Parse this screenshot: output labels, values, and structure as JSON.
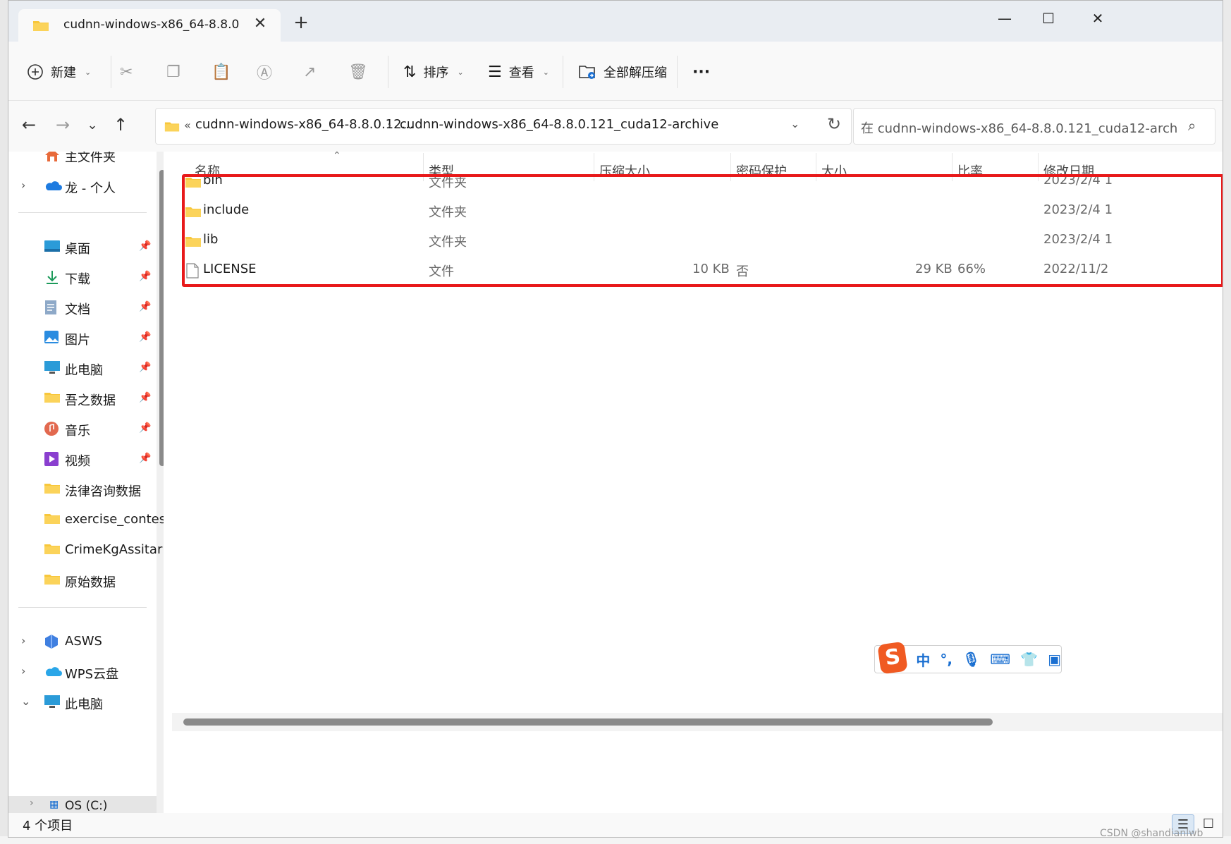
{
  "window": {
    "tab_title": "cudnn-windows-x86_64-8.8.0",
    "tab_close": "✕",
    "new_tab": "+",
    "minimize": "—",
    "maximize": "☐",
    "close": "✕"
  },
  "toolbar": {
    "new_label": "新建",
    "sort_label": "排序",
    "view_label": "查看",
    "extract_label": "全部解压缩",
    "more_label": "···"
  },
  "address": {
    "crumb_overflow": "«",
    "crumbs": [
      "cudnn-windows-x86_64-8.8.0.12...",
      "cudnn-windows-x86_64-8.8.0.121_cuda12-archive"
    ],
    "crumb_separator": "›",
    "search_placeholder": "在 cudnn-windows-x86_64-8.8.0.121_cuda12-arch..."
  },
  "sidebar": {
    "items": [
      {
        "label": "主文件夹",
        "icon": "home-icon",
        "pinned": false,
        "expander": ""
      },
      {
        "label": "龙 - 个人",
        "icon": "onedrive-icon",
        "pinned": false,
        "expander": "›"
      },
      {
        "label": "桌面",
        "icon": "desktop-icon",
        "pinned": true
      },
      {
        "label": "下载",
        "icon": "download-icon",
        "pinned": true
      },
      {
        "label": "文档",
        "icon": "documents-icon",
        "pinned": true
      },
      {
        "label": "图片",
        "icon": "pictures-icon",
        "pinned": true
      },
      {
        "label": "此电脑",
        "icon": "computer-icon",
        "pinned": true
      },
      {
        "label": "吾之数据",
        "icon": "folder-icon",
        "pinned": true
      },
      {
        "label": "音乐",
        "icon": "music-icon",
        "pinned": true
      },
      {
        "label": "视频",
        "icon": "video-icon",
        "pinned": true
      },
      {
        "label": "法律咨询数据",
        "icon": "folder-icon",
        "pinned": false
      },
      {
        "label": "exercise_contes",
        "icon": "folder-icon",
        "pinned": false
      },
      {
        "label": "CrimeKgAssitar",
        "icon": "folder-icon",
        "pinned": false
      },
      {
        "label": "原始数据",
        "icon": "folder-icon",
        "pinned": false
      },
      {
        "label": "ASWS",
        "icon": "asws-icon",
        "pinned": false,
        "expander": "›"
      },
      {
        "label": "WPS云盘",
        "icon": "wps-cloud-icon",
        "pinned": false,
        "expander": "›"
      },
      {
        "label": "此电脑",
        "icon": "computer-icon",
        "pinned": false,
        "expander": "⌄"
      },
      {
        "label": "OS (C:)",
        "icon": "drive-icon",
        "pinned": false,
        "expander": "›"
      }
    ]
  },
  "columns": {
    "name": "名称",
    "type": "类型",
    "compressed_size": "压缩大小",
    "password": "密码保护",
    "size": "大小",
    "ratio": "比率",
    "modified": "修改日期"
  },
  "files": [
    {
      "name": "bin",
      "type": "文件夹",
      "compressed_size": "",
      "password": "",
      "size": "",
      "ratio": "",
      "modified": "2023/2/4 1",
      "icon": "folder-icon"
    },
    {
      "name": "include",
      "type": "文件夹",
      "compressed_size": "",
      "password": "",
      "size": "",
      "ratio": "",
      "modified": "2023/2/4 1",
      "icon": "folder-icon"
    },
    {
      "name": "lib",
      "type": "文件夹",
      "compressed_size": "",
      "password": "",
      "size": "",
      "ratio": "",
      "modified": "2023/2/4 1",
      "icon": "folder-icon"
    },
    {
      "name": "LICENSE",
      "type": "文件",
      "compressed_size": "10 KB",
      "password": "否",
      "size": "29 KB",
      "ratio": "66%",
      "modified": "2022/11/2",
      "icon": "file-icon"
    }
  ],
  "status": {
    "item_count": "4 个项目"
  },
  "ime": {
    "logo": "S",
    "lang": "中",
    "punct": "°,"
  },
  "watermark": "CSDN @shandianlwb",
  "colors": {
    "accent": "#0067c0",
    "highlight_box": "#e8191a",
    "folder": "#f8c73b"
  }
}
